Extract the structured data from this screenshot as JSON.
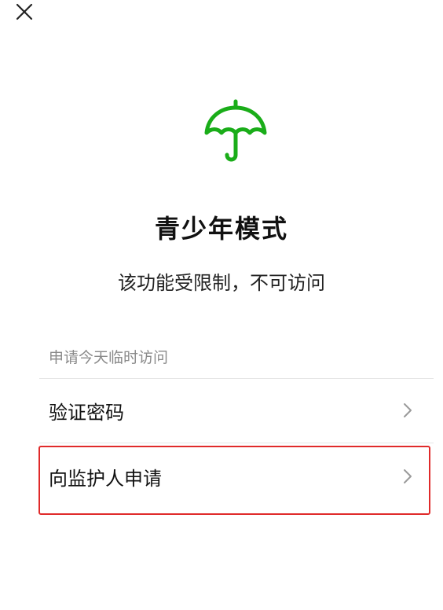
{
  "header": {
    "close_icon": "close-icon"
  },
  "hero": {
    "icon": "umbrella-icon",
    "icon_color": "#1aad19",
    "title": "青少年模式",
    "subtitle": "该功能受限制，不可访问"
  },
  "section": {
    "label": "申请今天临时访问"
  },
  "options": [
    {
      "label": "验证密码",
      "icon": "chevron-right-icon"
    },
    {
      "label": "向监护人申请",
      "icon": "chevron-right-icon",
      "highlighted": true
    }
  ],
  "colors": {
    "accent": "#1aad19",
    "highlight_border": "#e02a2a"
  }
}
